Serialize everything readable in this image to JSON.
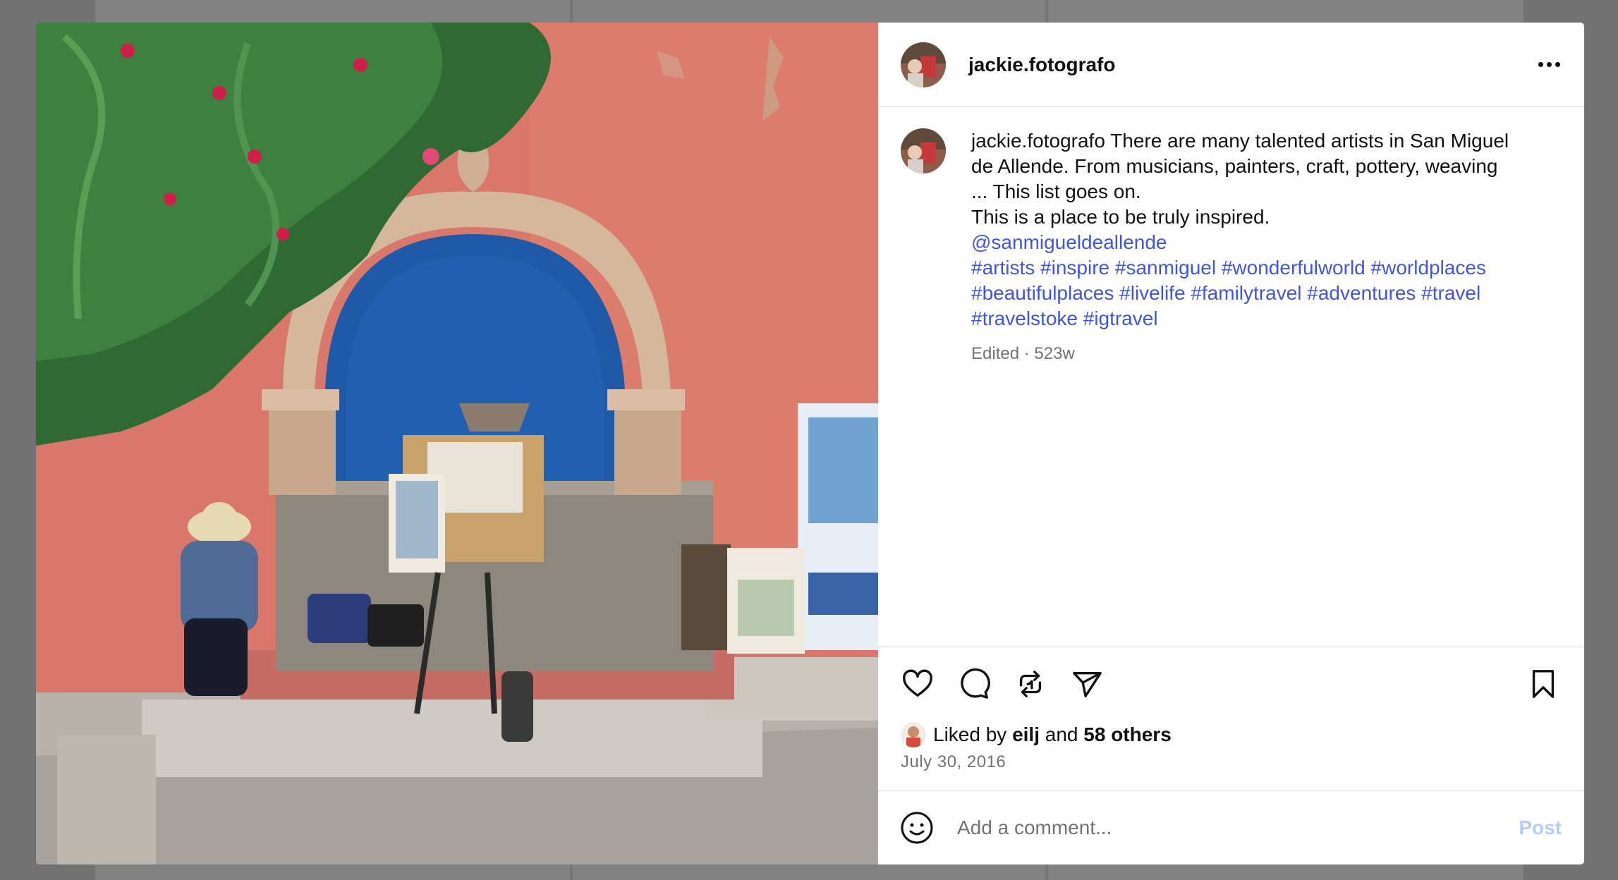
{
  "post": {
    "username": "jackie.fotografo",
    "caption_user": "jackie.fotografo",
    "caption_lines": [
      "There are many talented artists in San Miguel",
      "de Allende. From musicians, painters, craft, pottery, weaving",
      "... This list goes on.",
      "This is a place to be truly inspired."
    ],
    "mention": "@sanmigueldeallende",
    "hashtags": [
      "#artists",
      "#inspire",
      "#sanmiguel",
      "#wonderfulworld",
      "#worldplaces",
      "#beautifulplaces",
      "#livelife",
      "#familytravel",
      "#adventures",
      "#travel",
      "#travelstoke",
      "#igtravel"
    ],
    "edited_label": "Edited",
    "age": "523w",
    "liked_by_prefix": "Liked by",
    "liked_by_user": "eilj",
    "liked_by_and": "and",
    "liked_by_others": "58 others",
    "date": "July 30, 2016"
  },
  "icons": {
    "more": "more-options-icon",
    "like": "heart-icon",
    "comment": "comment-bubble-icon",
    "share": "repost-icon",
    "send": "send-icon",
    "save": "bookmark-icon",
    "emoji": "emoji-smile-icon"
  },
  "comment_box": {
    "placeholder": "Add a comment...",
    "post_label": "Post"
  },
  "colors": {
    "link": "#4150f7",
    "post_disabled": "#b3cff9",
    "secondary_text": "#737373"
  }
}
